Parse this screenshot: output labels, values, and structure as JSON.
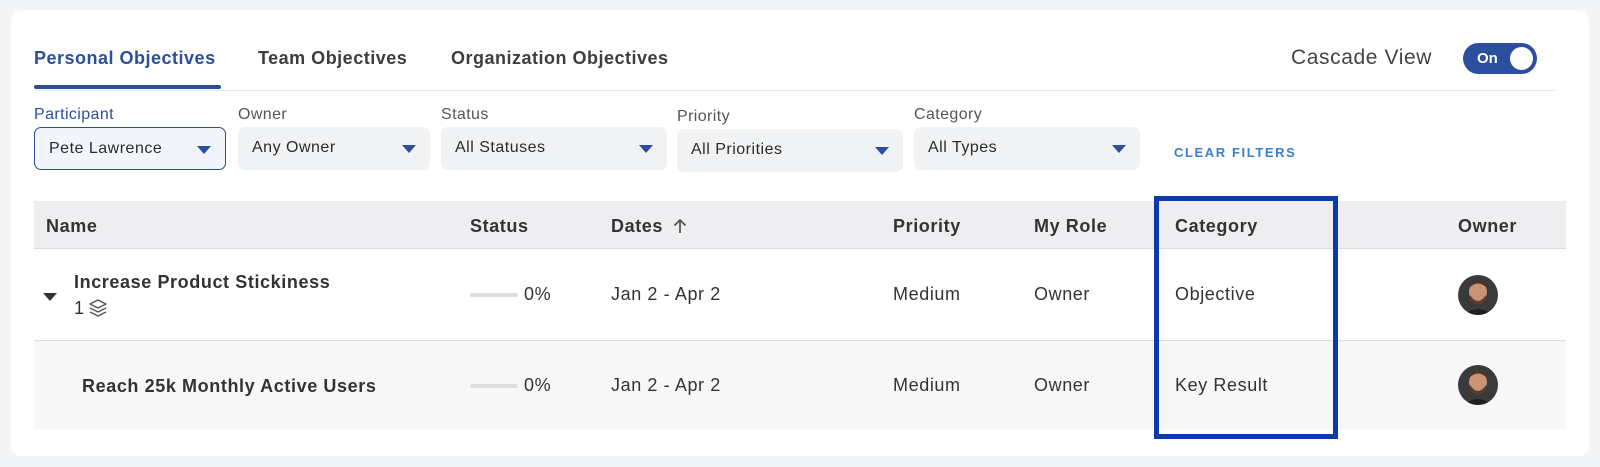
{
  "tabs": [
    {
      "label": "Personal Objectives",
      "active": true
    },
    {
      "label": "Team Objectives",
      "active": false
    },
    {
      "label": "Organization Objectives",
      "active": false
    }
  ],
  "cascade": {
    "label": "Cascade View",
    "toggle_label": "On"
  },
  "filters": {
    "participant": {
      "label": "Participant",
      "value": "Pete Lawrence"
    },
    "owner": {
      "label": "Owner",
      "value": "Any Owner"
    },
    "status": {
      "label": "Status",
      "value": "All Statuses"
    },
    "priority": {
      "label": "Priority",
      "value": "All Priorities"
    },
    "category": {
      "label": "Category",
      "value": "All Types"
    },
    "clear_label": "CLEAR FILTERS"
  },
  "table": {
    "headers": {
      "name": "Name",
      "status": "Status",
      "dates": "Dates",
      "priority": "Priority",
      "role": "My Role",
      "category": "Category",
      "owner": "Owner"
    },
    "rows": [
      {
        "name": "Increase Product Stickiness",
        "child_count": "1",
        "progress": "0%",
        "dates": "Jan 2 - Apr 2",
        "priority": "Medium",
        "role": "Owner",
        "category": "Objective"
      },
      {
        "name": "Reach 25k Monthly Active Users",
        "progress": "0%",
        "dates": "Jan 2 - Apr 2",
        "priority": "Medium",
        "role": "Owner",
        "category": "Key Result"
      }
    ]
  },
  "colors": {
    "accent": "#2b4f9e",
    "highlight_box": "#0b3ba8",
    "link": "#3a7fd0"
  }
}
